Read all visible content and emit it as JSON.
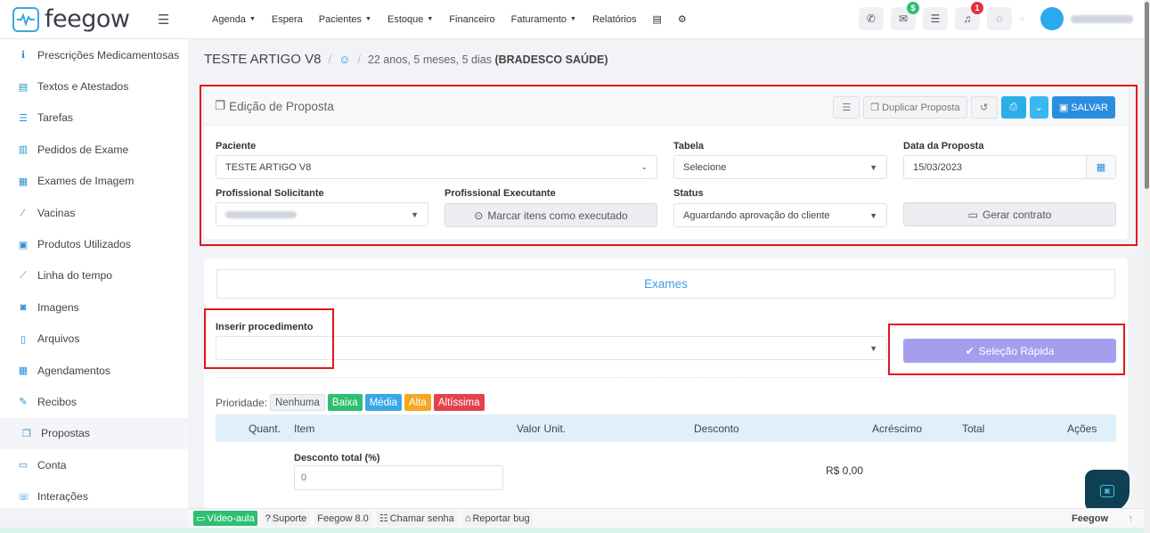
{
  "brand": {
    "name": "feegow"
  },
  "topnav": [
    {
      "label": "Agenda",
      "caret": true
    },
    {
      "label": "Espera",
      "caret": false
    },
    {
      "label": "Pacientes",
      "caret": true
    },
    {
      "label": "Estoque",
      "caret": true
    },
    {
      "label": "Financeiro",
      "caret": false
    },
    {
      "label": "Faturamento",
      "caret": true
    },
    {
      "label": "Relatórios",
      "caret": false
    }
  ],
  "topbar": {
    "badge_money": "$",
    "badge_notifications": "1"
  },
  "sidebar": {
    "items": [
      {
        "label": "Prescrições Medicamentosas",
        "icon": "pills-icon",
        "glyph": "ℹ"
      },
      {
        "label": "Textos e Atestados",
        "icon": "document-icon",
        "glyph": "▤"
      },
      {
        "label": "Tarefas",
        "icon": "tasks-icon",
        "glyph": "☰"
      },
      {
        "label": "Pedidos de Exame",
        "icon": "flask-icon",
        "glyph": "▥"
      },
      {
        "label": "Exames de Imagem",
        "icon": "image-grid-icon",
        "glyph": "▦"
      },
      {
        "label": "Vacinas",
        "icon": "syringe-icon",
        "glyph": "⁄"
      },
      {
        "label": "Produtos Utilizados",
        "icon": "box-icon",
        "glyph": "▣"
      },
      {
        "label": "Linha do tempo",
        "icon": "timeline-icon",
        "glyph": "⟋"
      },
      {
        "label": "Imagens",
        "icon": "camera-icon",
        "glyph": "◙"
      },
      {
        "label": "Arquivos",
        "icon": "file-icon",
        "glyph": "▯"
      },
      {
        "label": "Agendamentos",
        "icon": "calendar-icon",
        "glyph": "▦"
      },
      {
        "label": "Recibos",
        "icon": "edit-icon",
        "glyph": "✎"
      },
      {
        "label": "Propostas",
        "icon": "copy-icon",
        "glyph": "❐"
      },
      {
        "label": "Conta",
        "icon": "money-icon",
        "glyph": "▭"
      },
      {
        "label": "Interações",
        "icon": "phone-icon",
        "glyph": "☏"
      }
    ],
    "active_index": 12
  },
  "breadcrumb": {
    "patient": "TESTE ARTIGO V8",
    "age": "22 anos, 5 meses, 5 dias",
    "plan": "(BRADESCO SAÚDE)"
  },
  "proposal": {
    "title": "Edição de Proposta",
    "actions": {
      "duplicate": "Duplicar Proposta",
      "save": "SALVAR"
    },
    "fields": {
      "patient_label": "Paciente",
      "patient_value": "TESTE ARTIGO V8",
      "table_label": "Tabela",
      "table_value": "Selecione",
      "date_label": "Data da Proposta",
      "date_value": "15/03/2023",
      "requester_label": "Profissional Solicitante",
      "executor_label": "Profissional Executante",
      "mark_executed": "Marcar itens como executado",
      "status_label": "Status",
      "status_value": "Aguardando aprovação do cliente",
      "contract_button": "Gerar contrato"
    }
  },
  "exams": {
    "tab_label": "Exames",
    "insert_label": "Inserir procedimento",
    "quick_select": "Seleção Rápida",
    "priority_label": "Prioridade:",
    "priorities": [
      "Nenhuma",
      "Baixa",
      "Média",
      "Alta",
      "Altíssima"
    ],
    "columns": [
      "Quant.",
      "Item",
      "Valor Unit.",
      "Desconto",
      "Acréscimo",
      "Total",
      "Ações"
    ],
    "discount_label": "Desconto total (%)",
    "discount_value": "0",
    "total_value": "R$ 0,00"
  },
  "footer": {
    "video": "Vídeo-aula",
    "support": "Suporte",
    "version": "Feegow 8.0",
    "call_password": "Chamar senha",
    "report_bug": "Reportar bug",
    "brand": "Feegow"
  },
  "colors": {
    "accent": "#2c8fd4",
    "save": "#2a8ee0",
    "quick_select": "#a59dee",
    "highlight_box": "#e3141c",
    "table_header": "#dff0fb"
  }
}
